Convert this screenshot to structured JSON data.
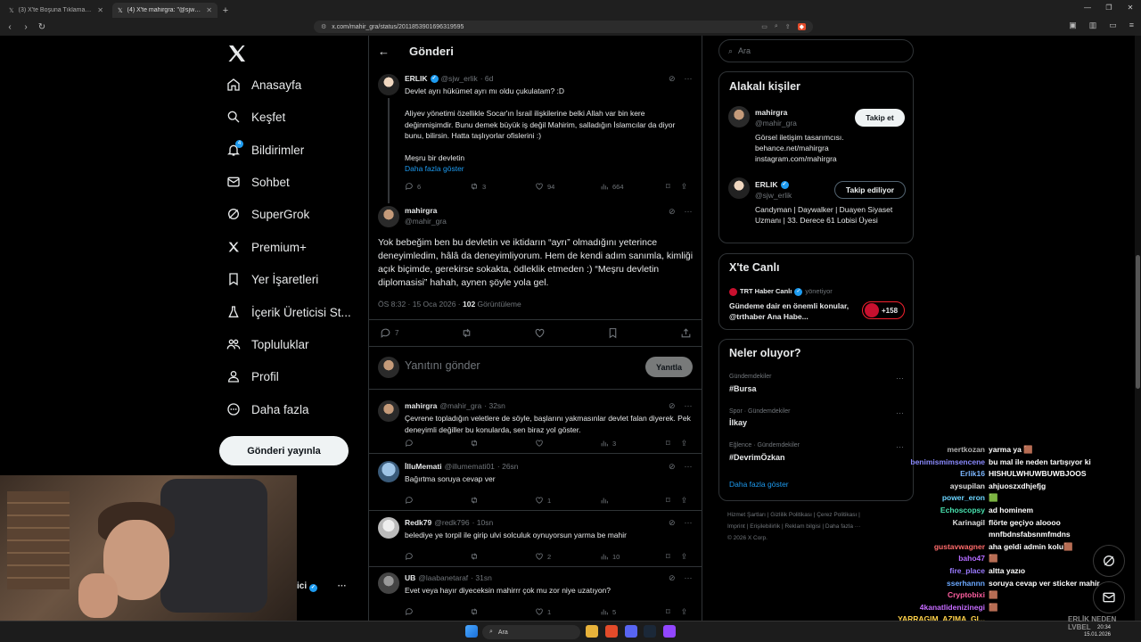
{
  "browser": {
    "tabs": [
      {
        "label": "(3) X'te Boşuna Tıklama: \"Türkiye, en"
      },
      {
        "label": "(4) X'te mahirgra: \"@sjw_erlik Yo"
      }
    ],
    "url": "x.com/mahir_gra/status/2011853901696319595"
  },
  "nav": {
    "items": [
      {
        "key": "home",
        "label": "Anasayfa"
      },
      {
        "key": "explore",
        "label": "Keşfet"
      },
      {
        "key": "notifications",
        "label": "Bildirimler",
        "badge": "4"
      },
      {
        "key": "chat",
        "label": "Sohbet"
      },
      {
        "key": "grok",
        "label": "SuperGrok"
      },
      {
        "key": "premium",
        "label": "Premium+"
      },
      {
        "key": "bookmarks",
        "label": "Yer İşaretleri"
      },
      {
        "key": "creator",
        "label": "İçerik Üreticisi St..."
      },
      {
        "key": "communities",
        "label": "Topluluklar"
      },
      {
        "key": "profile",
        "label": "Profil"
      },
      {
        "key": "more",
        "label": "Daha fazla"
      }
    ],
    "post_button": "Gönderi yayınla"
  },
  "main": {
    "title": "Gönderi",
    "parent": {
      "name": "ERLIK",
      "handle": "@sjw_erlik",
      "time": "· 6d",
      "line1": "Devlet ayrı hükümet ayrı mı oldu çukulatam? :D",
      "body": "Aliyev yönetimi özellikle Socar'ın İsrail ilişkilerine belki Allah var bin kere değinmişimdir. Bunu demek büyük iş değil Mahirim, salladığın İslamcılar da diyor bunu, bilirsin. Hatta taşlıyorlar ofislerini :)",
      "line3": "Meşru bir devletin",
      "more": "Daha fazla göster",
      "stats": {
        "replies": "6",
        "reposts": "3",
        "likes": "94",
        "views": "664"
      }
    },
    "focus": {
      "name": "mahirgra",
      "handle": "@mahir_gra",
      "text": "Yok bebeğim ben bu devletin ve iktidarın “ayrı” olmadığını yeterince deneyimledim, hâlâ da deneyimliyorum. Hem de kendi adım sanımla, kimliği açık biçimde, gerekirse sokakta, ödleklik etmeden :) “Meşru devletin diplomasisi” hahah, aynen şöyle yola gel.",
      "time": "ÖS 8:32 · 15 Oca 2026 · ",
      "views": "102",
      "views_label": " Görüntüleme",
      "replies": "7"
    },
    "reply_box": {
      "placeholder": "Yanıtını gönder",
      "button": "Yanıtla"
    },
    "replies": [
      {
        "name": "mahirgra",
        "handle": "@mahir_gra",
        "time": "· 32sn",
        "text": "Çevrene topladığın veletlere de söyle, başlarını yakmasınlar devlet falan diyerek. Pek deneyimli değiller bu konularda, sen biraz yol göster.",
        "reply": "",
        "repost": "",
        "like": "",
        "views": "3"
      },
      {
        "name": "İlluMemati",
        "handle": "@illumemati01",
        "time": "· 26sn",
        "text": "Bağırtma soruya cevap ver",
        "reply": "",
        "repost": "",
        "like": "1",
        "views": ""
      },
      {
        "name": "Redk79",
        "handle": "@redk796",
        "time": "· 10sn",
        "text": "belediye ye torpil ile girip ulvi solculuk oynuyorsun yarma be mahir",
        "reply": "",
        "repost": "",
        "like": "2",
        "views": "10"
      },
      {
        "name": "UB",
        "handle": "@laabanetaraf",
        "time": "· 31sn",
        "text": "Evet veya hayır diyeceksin mahirrr çok mu zor niye uzatıyon?",
        "reply": "",
        "repost": "",
        "like": "1",
        "views": "5"
      }
    ]
  },
  "sidebar_right": {
    "search_placeholder": "Ara",
    "related": {
      "title": "Alakalı kişiler",
      "people": [
        {
          "name": "mahirgra",
          "handle": "@mahir_gra",
          "button": "Takip et",
          "bio": "Görsel iletişim tasarımcısı.",
          "link1": "behance.net/mahirgra",
          "link2": "instagram.com/mahirgra"
        },
        {
          "name": "ERLIK",
          "handle": "@sjw_erlik",
          "button": "Takip ediliyor",
          "bio": "Candyman | Daywalker | Duayen Siyaset Uzmanı | 33. Derece 61 Lobisi Üyesi"
        }
      ]
    },
    "live": {
      "title": "X'te Canlı",
      "host": "TRT Haber Canlı",
      "role": "yönetiyor",
      "text": "Gündeme dair en önemli konular, @trthaber Ana Habe...",
      "count": "+158"
    },
    "trends": {
      "title": "Neler oluyor?",
      "items": [
        {
          "cat": "Gündemdekiler",
          "name": "#Bursa"
        },
        {
          "cat": "Spor · Gündemdekiler",
          "name": "İlkay"
        },
        {
          "cat": "Eğlence · Gündemdekiler",
          "name": "#DevrimÖzkan"
        }
      ],
      "more": "Daha fazla göster"
    },
    "footer": {
      "l1": [
        "Hizmet Şartları",
        "Gizlilik Politikası",
        "Çerez Politikası"
      ],
      "l2": [
        "Imprint",
        "Erişilebilirlik",
        "Reklam bilgisi",
        "Daha fazla ···"
      ],
      "copy": "© 2026 X Corp."
    }
  },
  "overlay": {
    "covered_name": "ici",
    "chat": [
      {
        "user": "mertkozan",
        "msg": "yarma ya 🟫",
        "color": "#b0b0b0"
      },
      {
        "user": "benimismimsencene",
        "msg": "bu mal ile neden tartışıyor ki",
        "color": "#8a8aff"
      },
      {
        "user": "Erlik16",
        "msg": "HISHULWHUWBUWBJOOS",
        "color": "#7db7ff"
      },
      {
        "user": "aysupilan",
        "msg": "ahjuoszxdhjefjg",
        "color": "#e0e0e0"
      },
      {
        "user": "power_eron",
        "msg": "🟩",
        "color": "#6bd4ff"
      },
      {
        "user": "Echoscopsy",
        "msg": "ad hominem",
        "color": "#49e3b0"
      },
      {
        "user": "Karinagil",
        "msg": "flörte geçiyo aloooo",
        "color": "#e0e0e0"
      },
      {
        "user": "",
        "msg": "mnfbdnsfabsnmfmdns",
        "color": "#e0e0e0"
      },
      {
        "user": "gustavwagner",
        "msg": "aha geldi admin kolu🟫",
        "color": "#ff6b6b"
      },
      {
        "user": "baho47",
        "msg": "🟫",
        "color": "#b46bff"
      },
      {
        "user": "fire_place",
        "msg": "altta yazıo",
        "color": "#9b7bff"
      },
      {
        "user": "sserhannn",
        "msg": "soruya cevap ver sticker mahir",
        "color": "#6ba8ff"
      },
      {
        "user": "Cryptobixi",
        "msg": "🟫",
        "color": "#ff5fa0"
      },
      {
        "user": "4kanatlidenizinegi",
        "msg": "🟫",
        "color": "#c66bff"
      },
      {
        "user": "YARRAGIM_AZIMA_GI...",
        "msg": "",
        "color": "#ffd24a"
      }
    ],
    "bottom_text": "ERLİK NEDEN LVBEL"
  },
  "taskbar": {
    "search": "Ara",
    "time": "20:34",
    "date": "15.01.2026"
  },
  "colors": {
    "accent": "#1d9bf0",
    "bg": "#000000",
    "border": "#2f3336",
    "muted": "#71767b"
  }
}
